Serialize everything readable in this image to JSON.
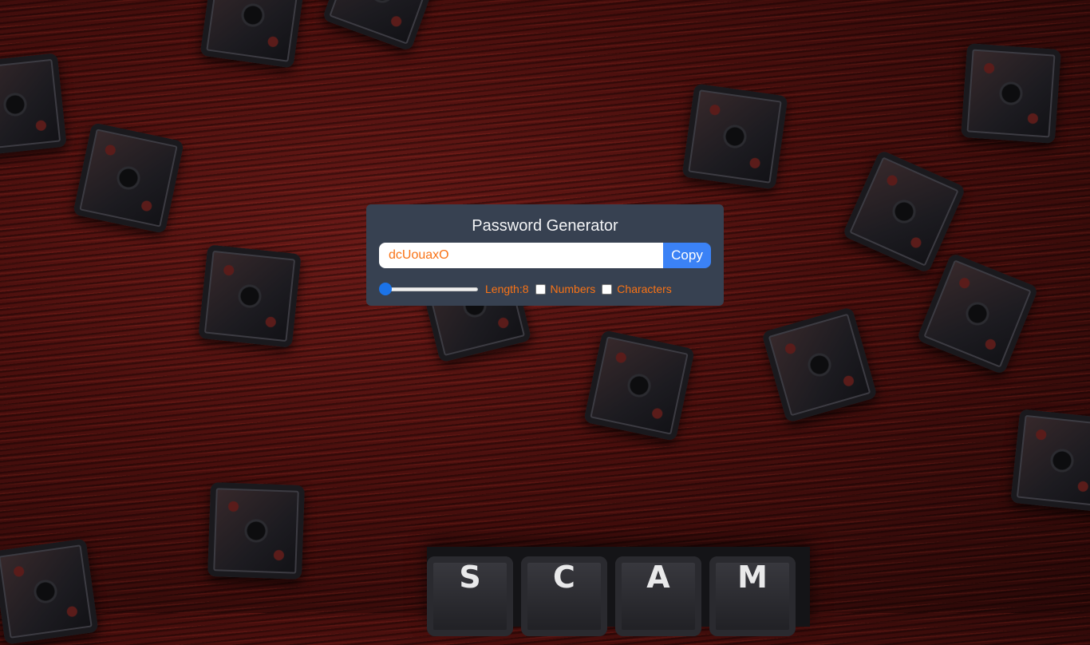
{
  "app": {
    "title": "Password Generator"
  },
  "password": {
    "value": "dcUouaxO"
  },
  "copy_button": {
    "label": "Copy"
  },
  "length": {
    "label": "Length:8",
    "value": 8,
    "slider_fraction": 0.0
  },
  "options": {
    "numbers": {
      "label": "Numbers",
      "checked": false
    },
    "characters": {
      "label": "Characters",
      "checked": false
    }
  },
  "background_keys": {
    "letters": [
      "S",
      "C",
      "A",
      "M"
    ]
  },
  "colors": {
    "card": "#374151",
    "accent_text": "#f97316",
    "button": "#3b82f6",
    "slider": "#1b73e8"
  }
}
